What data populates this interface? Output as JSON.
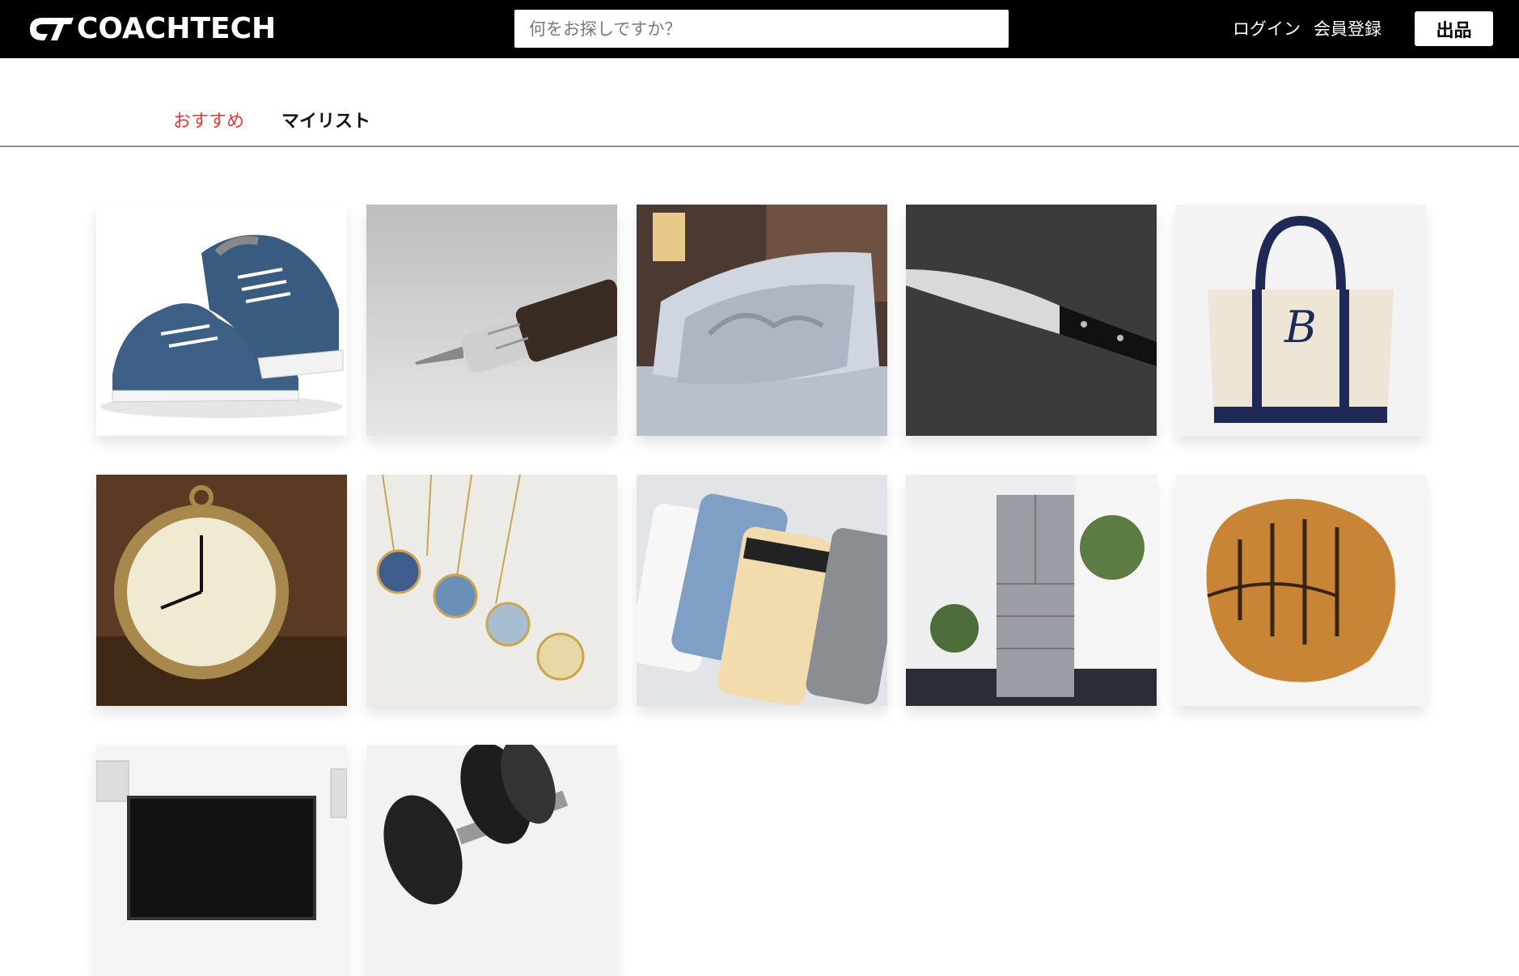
{
  "header": {
    "logo_text": "COACHTECH",
    "search_placeholder": "何をお探しですか？",
    "login_label": "ログイン",
    "register_label": "会員登録",
    "sell_label": "出品"
  },
  "tabs": [
    {
      "label": "おすすめ",
      "active": true
    },
    {
      "label": "マイリスト",
      "active": false
    }
  ],
  "colors": {
    "header_bg": "#000000",
    "active_tab": "#e03a3a"
  },
  "products": [
    {
      "icon": "sneakers-image"
    },
    {
      "icon": "mechanical-pencil-image"
    },
    {
      "icon": "pillow-image"
    },
    {
      "icon": "kitchen-knife-image"
    },
    {
      "icon": "tote-bag-image"
    },
    {
      "icon": "pocket-watch-image"
    },
    {
      "icon": "pendant-necklaces-image"
    },
    {
      "icon": "smartphones-image"
    },
    {
      "icon": "refrigerator-image"
    },
    {
      "icon": "baseball-glove-image"
    },
    {
      "icon": "television-image"
    },
    {
      "icon": "dumbbell-image"
    }
  ]
}
